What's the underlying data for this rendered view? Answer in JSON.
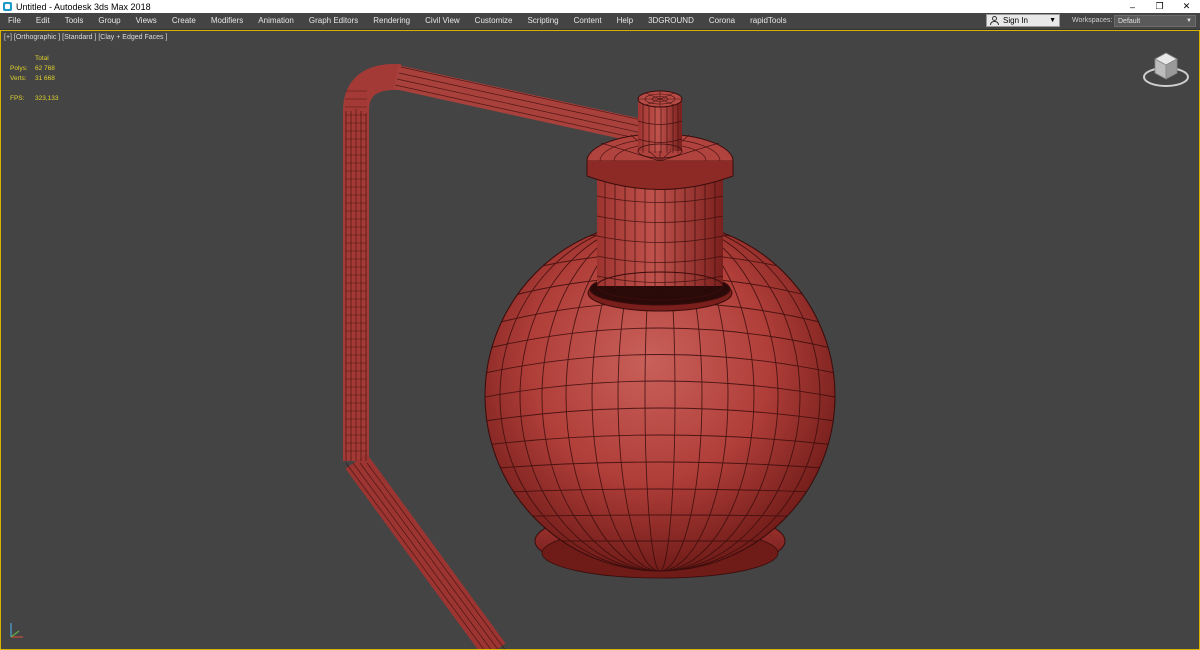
{
  "window": {
    "title": "Untitled - Autodesk 3ds Max 2018",
    "controls": [
      "minimize",
      "restore",
      "close"
    ]
  },
  "menu": [
    "File",
    "Edit",
    "Tools",
    "Group",
    "Views",
    "Create",
    "Modifiers",
    "Animation",
    "Graph Editors",
    "Rendering",
    "Civil View",
    "Customize",
    "Scripting",
    "Content",
    "Help",
    "3DGROUND",
    "Corona",
    "rapidTools"
  ],
  "account": {
    "sign_in": "Sign In"
  },
  "workspaces": {
    "label": "Workspaces:",
    "value": "Default"
  },
  "viewport": {
    "label": "[+] [Orthographic ] [Standard ] [Clay + Edged Faces ]",
    "stats": {
      "header": "Total",
      "polys_label": "Polys:",
      "polys_value": "62 768",
      "verts_label": "Verts:",
      "verts_value": "31 668",
      "fps_label": "FPS:",
      "fps_value": "323,133"
    }
  },
  "colors": {
    "viewport_bg": "#444444",
    "clay": "#b4433f",
    "wire": "#3a0d0c",
    "stats_text": "#e1d22e",
    "active_border": "#d6b400"
  },
  "icons": {
    "app": "3dsmax-app-icon",
    "signin": "user-icon",
    "viewcube": "viewcube-icon",
    "axis": "axis-tripod-icon"
  }
}
